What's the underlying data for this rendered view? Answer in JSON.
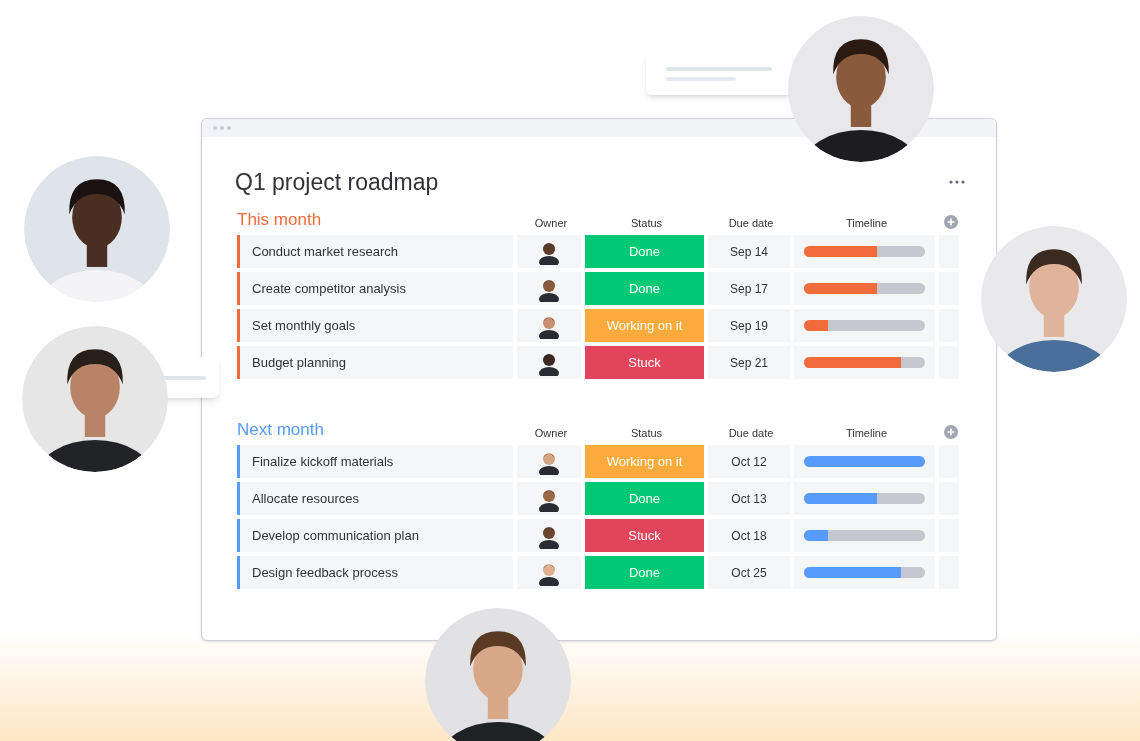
{
  "window": {
    "title": "Q1 project roadmap"
  },
  "groups": [
    {
      "title": "This month",
      "color": "#f26b3a",
      "columns": [
        "Owner",
        "Status",
        "Due date",
        "Timeline"
      ],
      "rows": [
        {
          "task": "Conduct market research",
          "status": {
            "label": "Done",
            "color": "#00c875"
          },
          "due": "Sep 14",
          "level": 0.6
        },
        {
          "task": "Create competitor analysis",
          "status": {
            "label": "Done",
            "color": "#00c875"
          },
          "due": "Sep 17",
          "level": 0.6
        },
        {
          "task": "Set monthly goals",
          "status": {
            "label": "Working on it",
            "color": "#fdab3d"
          },
          "due": "Sep 19",
          "level": 0.2
        },
        {
          "task": "Budget planning",
          "status": {
            "label": "Stuck",
            "color": "#e2445c"
          },
          "due": "Sep 21",
          "level": 0.8
        }
      ]
    },
    {
      "title": "Next month",
      "color": "#579bfc",
      "columns": [
        "Owner",
        "Status",
        "Due date",
        "Timeline"
      ],
      "rows": [
        {
          "task": "Finalize kickoff materials",
          "status": {
            "label": "Working on it",
            "color": "#fdab3d"
          },
          "due": "Oct 12",
          "level": 1.0
        },
        {
          "task": "Allocate resources",
          "status": {
            "label": "Done",
            "color": "#00c875"
          },
          "due": "Oct 13",
          "level": 0.6
        },
        {
          "task": "Develop communication plan",
          "status": {
            "label": "Stuck",
            "color": "#e2445c"
          },
          "due": "Oct 18",
          "level": 0.2
        },
        {
          "task": "Design feedback process",
          "status": {
            "label": "Done",
            "color": "#00c875"
          },
          "due": "Oct 25",
          "level": 0.8
        }
      ]
    }
  ]
}
